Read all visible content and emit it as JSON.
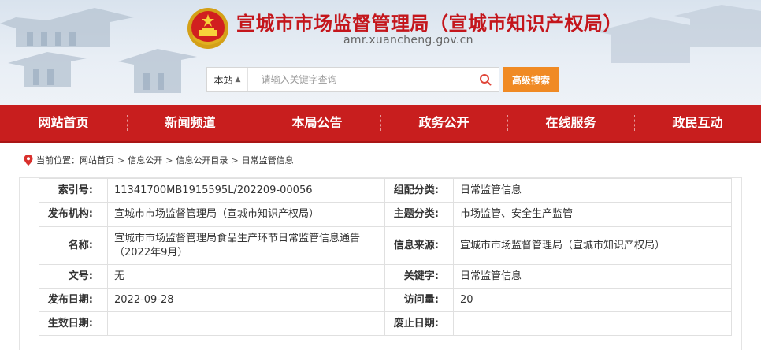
{
  "header": {
    "site_title": "宣城市市场监督管理局（宣城市知识产权局）",
    "site_domain": "amr.xuancheng.gov.cn",
    "emblem_icon": "national-emblem-icon",
    "brand_red": "#c4161c"
  },
  "search": {
    "scope_label": "本站",
    "placeholder": "--请输入关键字查询--",
    "advanced_label": "高级搜索",
    "accent": "#f08a24"
  },
  "nav": {
    "items": [
      "网站首页",
      "新闻频道",
      "本局公告",
      "政务公开",
      "在线服务",
      "政民互动"
    ],
    "bg": "#c81e1e"
  },
  "breadcrumb": {
    "prefix": "当前位置：",
    "items": [
      "网站首页",
      "信息公开",
      "信息公开目录",
      "日常监管信息"
    ],
    "separator": ">"
  },
  "info": {
    "rows": [
      {
        "k1": "索引号:",
        "v1": "11341700MB1915595L/202209-00056",
        "k2": "组配分类:",
        "v2": "日常监管信息"
      },
      {
        "k1": "发布机构:",
        "v1": "宣城市市场监督管理局（宣城市知识产权局）",
        "k2": "主题分类:",
        "v2": "市场监管、安全生产监管"
      },
      {
        "k1": "名称:",
        "v1": "宣城市市场监督管理局食品生产环节日常监管信息通告（2022年9月）",
        "k2": "信息来源:",
        "v2": "宣城市市场监督管理局（宣城市知识产权局）"
      },
      {
        "k1": "文号:",
        "v1": "无",
        "k2": "关键字:",
        "v2": "日常监管信息"
      },
      {
        "k1": "发布日期:",
        "v1": "2022-09-28",
        "k2": "访问量:",
        "v2": "20"
      },
      {
        "k1": "生效日期:",
        "v1": "",
        "k2": "废止日期:",
        "v2": ""
      }
    ]
  }
}
